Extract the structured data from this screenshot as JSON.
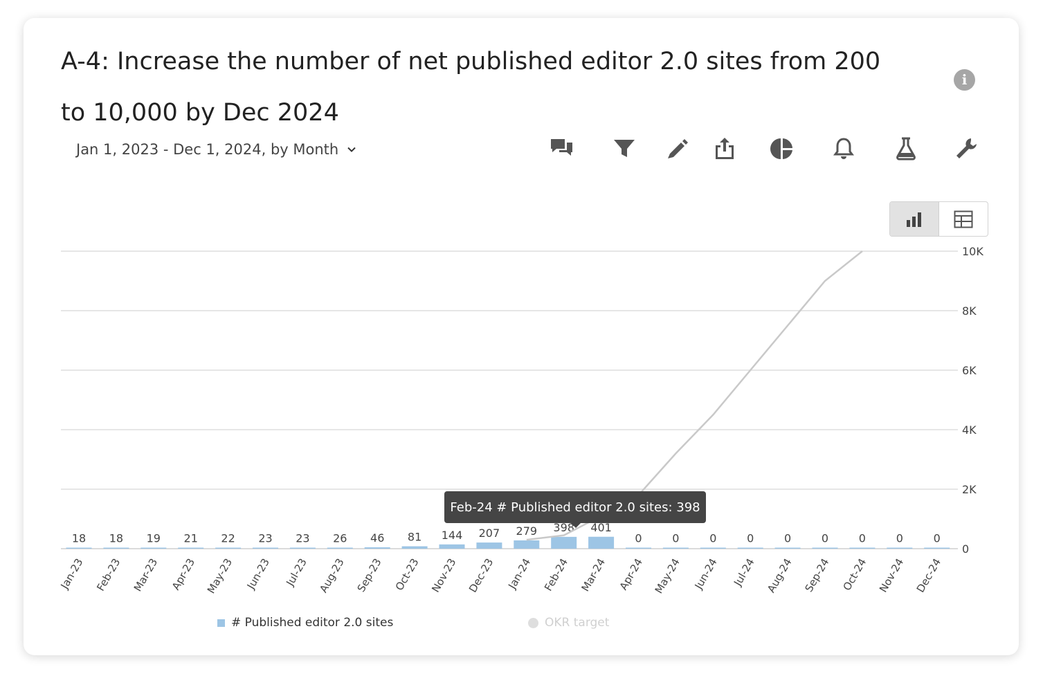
{
  "header": {
    "title": "A-4: Increase the number of net published editor 2.0 sites from 200 to 10,000 by Dec 2024",
    "date_range": "Jan 1, 2023 - Dec 1, 2024, by Month"
  },
  "toolbar": {
    "icons": [
      "comments-icon",
      "filter-icon",
      "pencil-icon",
      "share-icon",
      "pie-chart-icon",
      "bell-icon",
      "flask-icon",
      "wrench-icon"
    ]
  },
  "view_toggle": {
    "active": "chart",
    "options": [
      "bar-chart-icon",
      "table-icon"
    ]
  },
  "tooltip": {
    "text": "Feb-24 # Published editor 2.0 sites: 398"
  },
  "colors": {
    "bar": "#9dc5e5",
    "line": "#c9c9c9",
    "grid": "#dddddd",
    "tooltip_bg": "#454545"
  },
  "chart_data": {
    "type": "bar",
    "categories": [
      "Jan-23",
      "Feb-23",
      "Mar-23",
      "Apr-23",
      "May-23",
      "Jun-23",
      "Jul-23",
      "Aug-23",
      "Sep-23",
      "Oct-23",
      "Nov-23",
      "Dec-23",
      "Jan-24",
      "Feb-24",
      "Mar-24",
      "Apr-24",
      "May-24",
      "Jun-24",
      "Jul-24",
      "Aug-24",
      "Sep-24",
      "Oct-24",
      "Nov-24",
      "Dec-24"
    ],
    "series": [
      {
        "name": "# Published editor 2.0 sites",
        "type": "bar",
        "values": [
          18,
          18,
          19,
          21,
          22,
          23,
          23,
          26,
          46,
          81,
          144,
          207,
          279,
          398,
          401,
          0,
          0,
          0,
          0,
          0,
          0,
          0,
          0,
          0
        ]
      },
      {
        "name": "OKR target",
        "type": "line",
        "hidden": true,
        "values": [
          null,
          null,
          null,
          null,
          null,
          null,
          null,
          null,
          null,
          null,
          null,
          null,
          300,
          450,
          1100,
          1800,
          3200,
          4500,
          6000,
          7500,
          9000,
          10000,
          null,
          null
        ]
      }
    ],
    "yticks": [
      "0",
      "2K",
      "4K",
      "6K",
      "8K",
      "10K"
    ],
    "ylim": [
      0,
      10000
    ],
    "grid": true,
    "legend_position": "bottom"
  }
}
